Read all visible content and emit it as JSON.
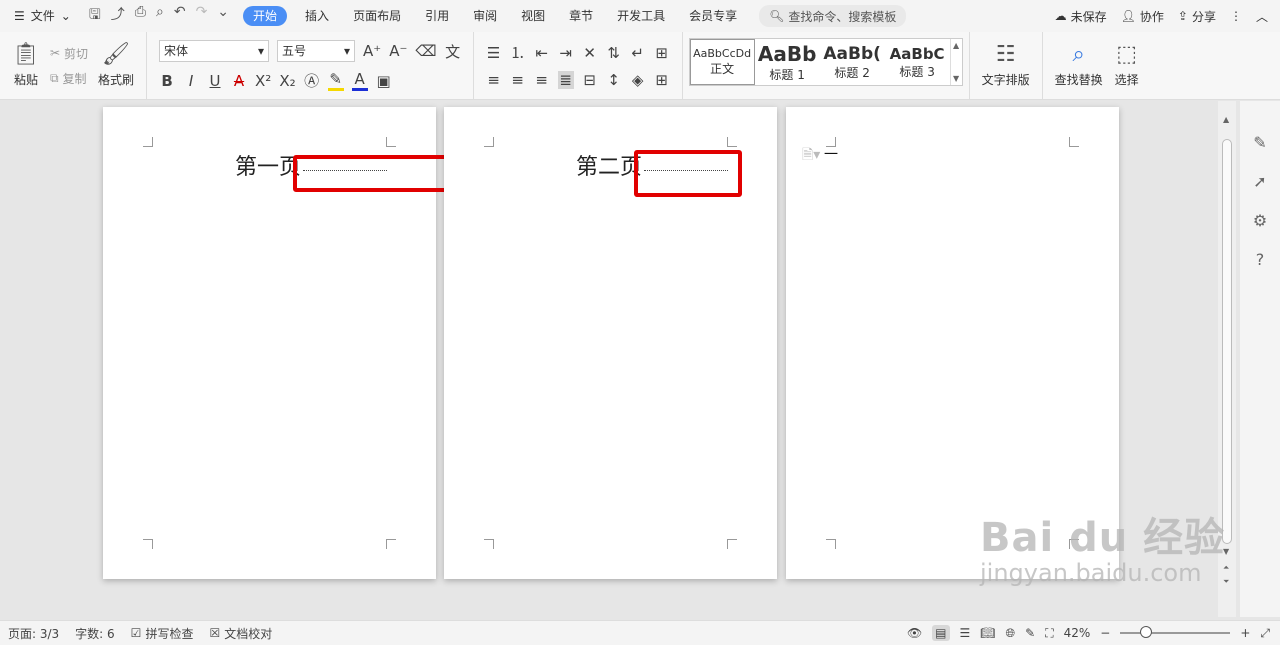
{
  "menubar": {
    "menu_label": "文件",
    "tabs": [
      "开始",
      "插入",
      "页面布局",
      "引用",
      "审阅",
      "视图",
      "章节",
      "开发工具",
      "会员专享"
    ],
    "search_placeholder": "查找命令、搜索模板",
    "unsaved": "未保存",
    "collab": "协作",
    "share": "分享"
  },
  "ribbon": {
    "paste": "粘贴",
    "cut": "剪切",
    "copy": "复制",
    "format_painter": "格式刷",
    "font_name": "宋体",
    "font_size": "五号",
    "styles": [
      {
        "sample": "AaBbCcDd",
        "name": "正文"
      },
      {
        "sample": "AaBb",
        "name": "标题 1"
      },
      {
        "sample": "AaBb(",
        "name": "标题 2"
      },
      {
        "sample": "AaBbC",
        "name": "标题 3"
      }
    ],
    "text_layout": "文字排版",
    "find_replace": "查找替换",
    "select": "选择"
  },
  "pages": [
    {
      "text": "第一页"
    },
    {
      "text": "第二页"
    },
    {
      "text": "一"
    }
  ],
  "watermark": {
    "line1": "Bai du 经验",
    "line2": "jingyan.baidu.com"
  },
  "status": {
    "page": "页面: 3/3",
    "words": "字数: 6",
    "spell": "拼写检查",
    "proof": "文档校对",
    "zoom": "42%"
  }
}
